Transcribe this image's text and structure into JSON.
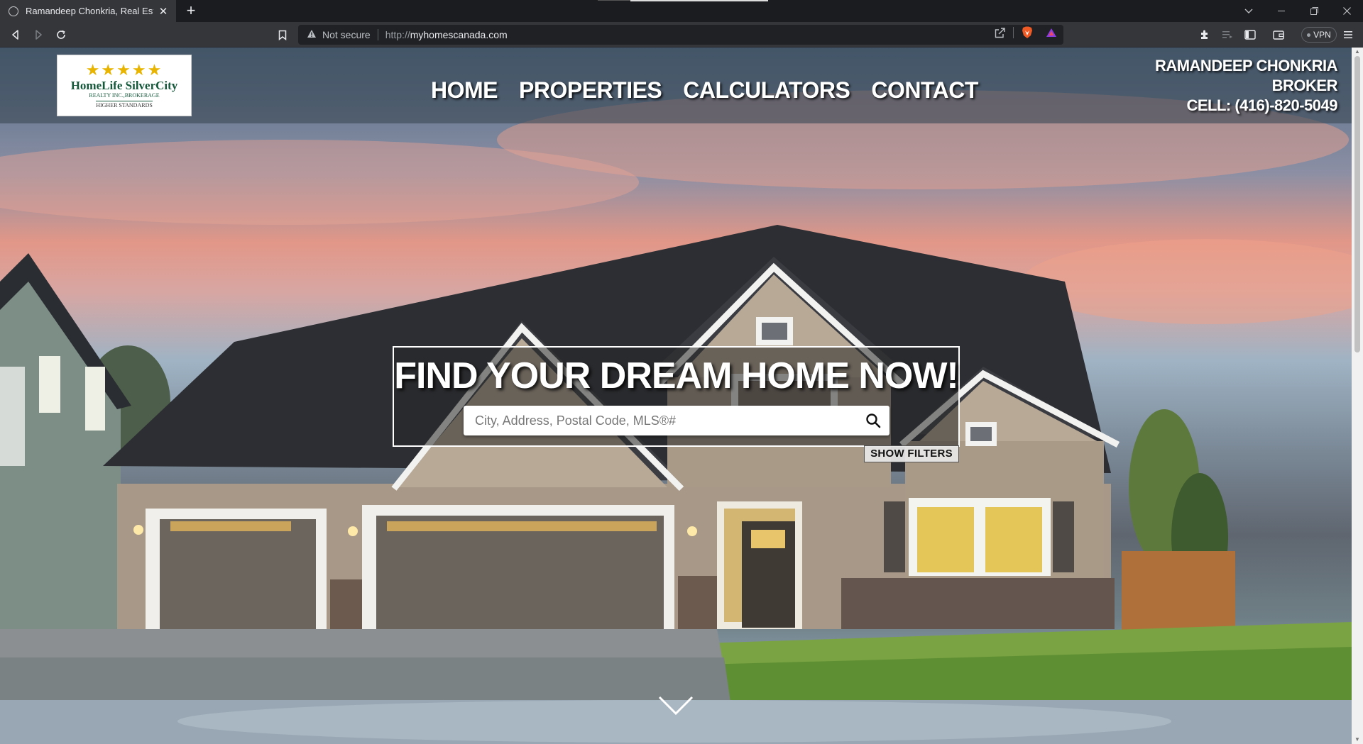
{
  "browser": {
    "tab_title": "Ramandeep Chonkria, Real Estate",
    "tab_close": "✕",
    "new_tab": "+",
    "security": "Not secure",
    "url_scheme": "http://",
    "url_host": "myhomescanada.com",
    "vpn_label": "VPN"
  },
  "site": {
    "logo": {
      "stars": "★★★★★",
      "name": "HomeLife SilverCity",
      "sub": "REALTY INC.,BROKERAGE",
      "tagline": "HIGHER STANDARDS"
    },
    "nav": {
      "home": "HOME",
      "properties": "PROPERTIES",
      "calculators": "CALCULATORS",
      "contact": "CONTACT"
    },
    "agent": {
      "name": "RAMANDEEP CHONKRIA",
      "title": "BROKER",
      "phone": "CELL: (416)-820-5049"
    },
    "hero": {
      "headline": "FIND YOUR DREAM HOME NOW!",
      "search_placeholder": "City, Address, Postal Code, MLS®#",
      "search_value": "",
      "filters_label": "SHOW FILTERS"
    }
  },
  "colors": {
    "header_overlay": "#3c4856",
    "logo_green": "#14583a",
    "logo_gold": "#e8b400"
  }
}
